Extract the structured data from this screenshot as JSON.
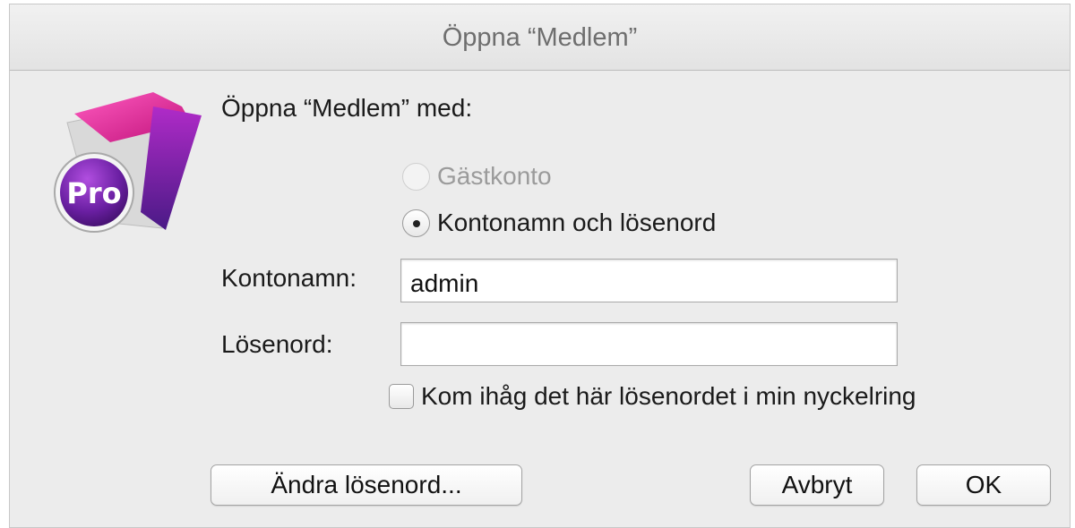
{
  "window": {
    "title": "Öppna “Medlem”"
  },
  "app_icon": {
    "name": "filemaker-pro-icon",
    "badge_text": "Pro",
    "colors": {
      "folder": "#e0188c",
      "accent": "#7b2cc6",
      "badge": "#5b1f8f"
    }
  },
  "dialog": {
    "prompt": "Öppna “Medlem” med:",
    "options": [
      {
        "label": "Gästkonto",
        "selected": false,
        "enabled": false
      },
      {
        "label": "Kontonamn och lösenord",
        "selected": true,
        "enabled": true
      }
    ],
    "account": {
      "label": "Kontonamn:",
      "value": "admin"
    },
    "password": {
      "label": "Lösenord:",
      "value": ""
    },
    "remember": {
      "label": "Kom ihåg det här lösenordet i min nyckelring",
      "checked": false
    }
  },
  "buttons": {
    "change_password": "Ändra lösenord...",
    "cancel": "Avbryt",
    "ok": "OK"
  }
}
